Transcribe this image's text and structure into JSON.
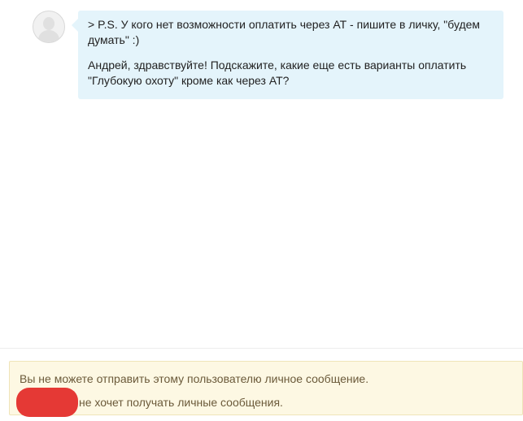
{
  "conversation": {
    "message": {
      "avatar_icon": "default-user-avatar-icon",
      "quote_text": "> P.S. У кого нет возможности оплатить через АТ - пишите в личку, \"будем думать\" :)",
      "body_text": "Андрей, здравствуйте! Подскажите, какие еще есть варианты оплатить \"Глубокую охоту\" кроме как через АТ?"
    }
  },
  "notice": {
    "line1": "Вы не можете отправить этому пользователю личное сообщение.",
    "line2": "не хочет получать личные сообщения."
  },
  "colors": {
    "bubble_background": "#e4f4fb",
    "notice_background": "#fdf8e3",
    "notice_text": "#6b5a3a",
    "redaction": "#e53935"
  }
}
